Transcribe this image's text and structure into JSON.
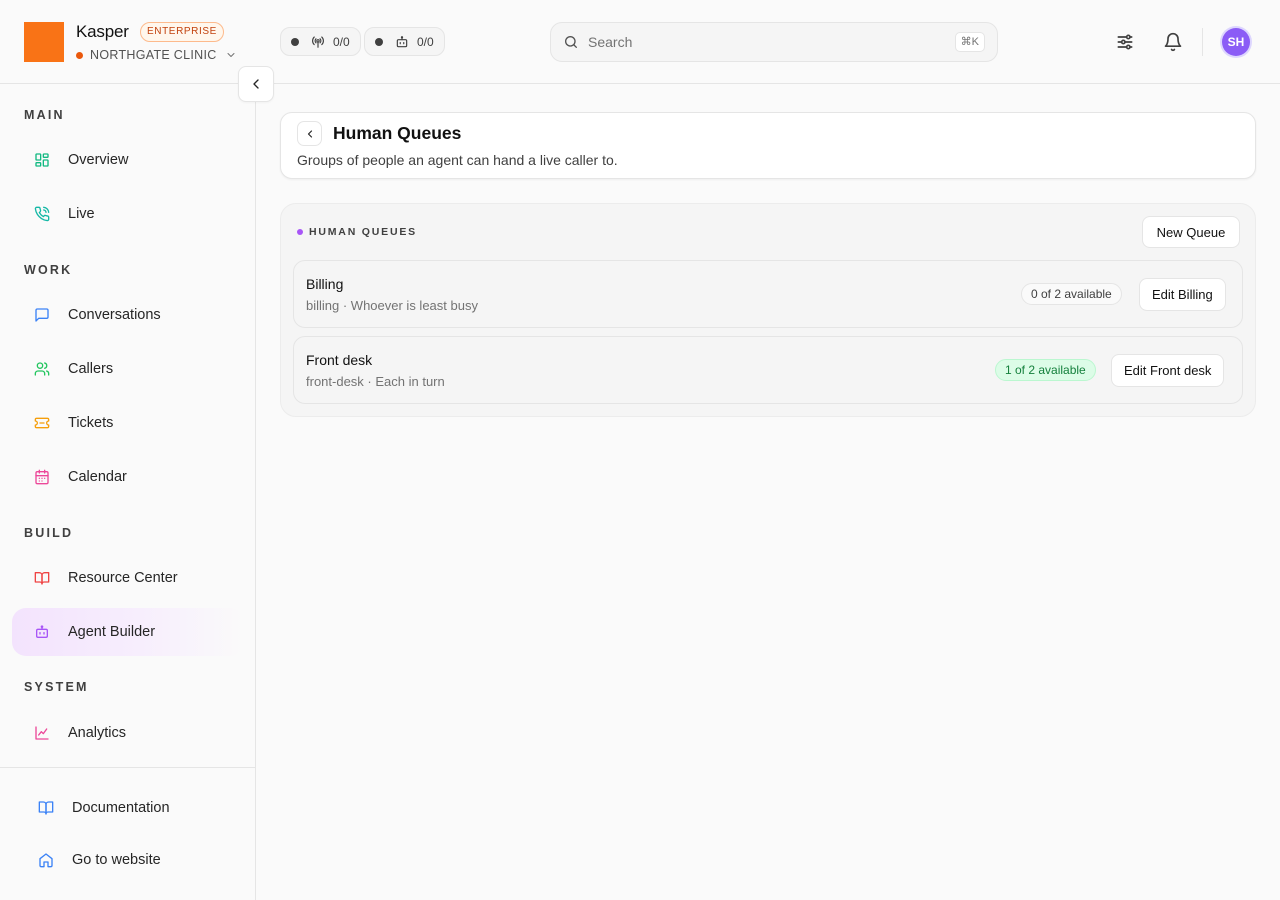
{
  "app": {
    "name": "Kasper",
    "plan_badge": "ENTERPRISE",
    "org_name": "NORTHGATE CLINIC",
    "brand_color": "#f97316"
  },
  "header": {
    "stats": [
      {
        "icon": "broadcast-icon",
        "value": "0/0"
      },
      {
        "icon": "bot-icon",
        "value": "0/0"
      }
    ],
    "search": {
      "placeholder": "Search",
      "shortcut": "⌘K"
    },
    "avatar_initials": "SH",
    "avatar_color": "#8b5cf6"
  },
  "sidebar": {
    "sections": {
      "main": "MAIN",
      "work": "WORK",
      "build": "BUILD",
      "system": "SYSTEM"
    },
    "items": [
      {
        "label": "Overview",
        "icon": "grid-icon",
        "color": "#10b981"
      },
      {
        "label": "Live",
        "icon": "phone-icon",
        "color": "#14b8a6"
      },
      {
        "label": "Conversations",
        "icon": "chat-icon",
        "color": "#3b82f6"
      },
      {
        "label": "Callers",
        "icon": "users-icon",
        "color": "#22c55e"
      },
      {
        "label": "Tickets",
        "icon": "ticket-icon",
        "color": "#f59e0b"
      },
      {
        "label": "Calendar",
        "icon": "calendar-icon",
        "color": "#ec4899"
      },
      {
        "label": "Resource Center",
        "icon": "book-icon",
        "color": "#ef4444"
      },
      {
        "label": "Agent Builder",
        "icon": "bot-icon",
        "color": "#a855f7",
        "active": true
      },
      {
        "label": "Analytics",
        "icon": "chart-icon",
        "color": "#ec4899"
      }
    ],
    "footer": [
      {
        "label": "Documentation",
        "icon": "book-open-icon",
        "color": "#3b82f6"
      },
      {
        "label": "Go to website",
        "icon": "home-icon",
        "color": "#3b82f6"
      }
    ]
  },
  "page": {
    "title": "Human Queues",
    "subtitle": "Groups of people an agent can hand a live caller to."
  },
  "queues_panel": {
    "label": "HUMAN QUEUES",
    "new_button": "New Queue",
    "queues": [
      {
        "name": "Billing",
        "meta": "billing · Whoever is least busy",
        "availability": "0 of 2 available",
        "available": 0,
        "total": 2,
        "edit_label": "Edit Billing"
      },
      {
        "name": "Front desk",
        "meta": "front-desk · Each in turn",
        "availability": "1 of 2 available",
        "available": 1,
        "total": 2,
        "edit_label": "Edit Front desk"
      }
    ]
  }
}
